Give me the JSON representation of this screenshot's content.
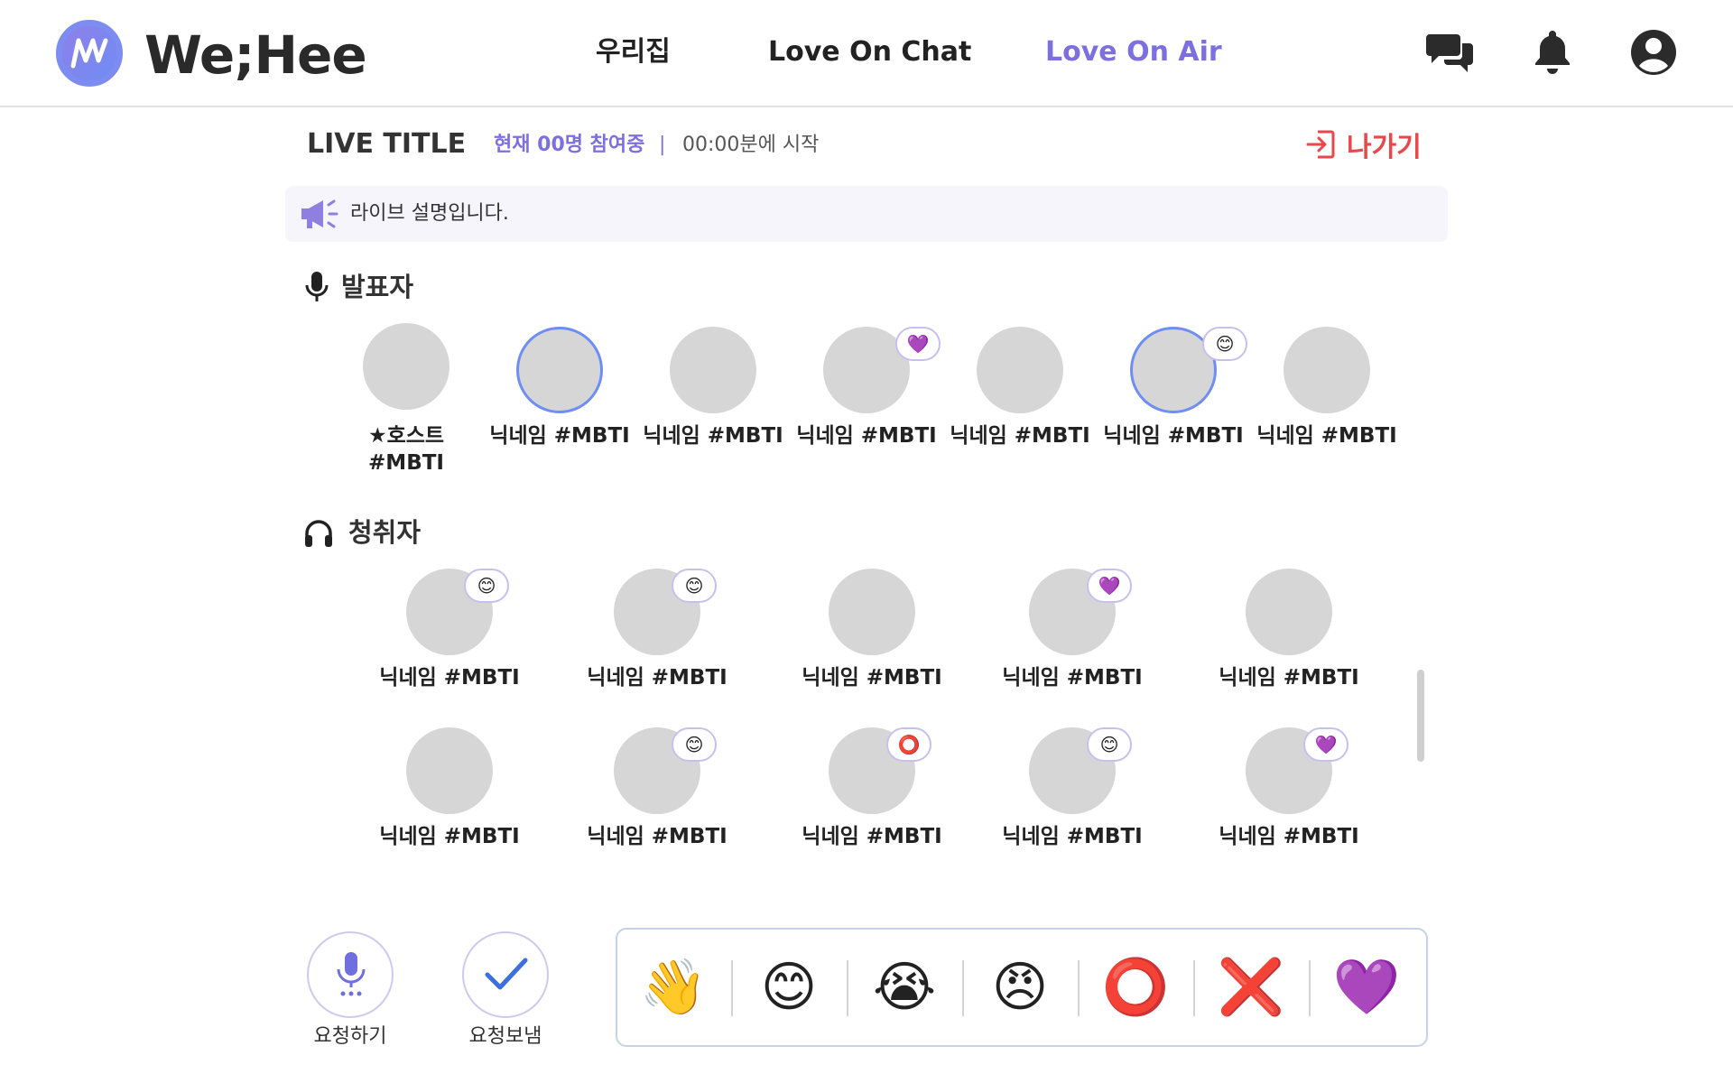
{
  "header": {
    "brand": "We;Hee",
    "nav": [
      "우리집",
      "Love On Chat",
      "Love On Air"
    ],
    "active_nav": "Love On Air",
    "icons": [
      "chat-icon",
      "bell-icon",
      "user-icon"
    ]
  },
  "live": {
    "title": "LIVE TITLE",
    "participants": "현재 00명 참여중",
    "separator": "|",
    "start": "00:00분에 시작",
    "exit_label": "나가기",
    "description": "라이브 설명입니다."
  },
  "speakers": {
    "title": "발표자",
    "items": [
      {
        "name": "호스트 #MBTI",
        "host": true,
        "reaction": ""
      },
      {
        "name": "닉네임 #MBTI",
        "speaking": true,
        "reaction": ""
      },
      {
        "name": "닉네임 #MBTI",
        "reaction": ""
      },
      {
        "name": "닉네임 #MBTI",
        "reaction": "💜"
      },
      {
        "name": "닉네임 #MBTI",
        "reaction": ""
      },
      {
        "name": "닉네임 #MBTI",
        "speaking": true,
        "reaction": "😊"
      },
      {
        "name": "닉네임 #MBTI",
        "reaction": ""
      }
    ]
  },
  "listeners": {
    "title": "청취자",
    "items": [
      {
        "name": "닉네임 #MBTI",
        "reaction": "😊"
      },
      {
        "name": "닉네임 #MBTI",
        "reaction": "😊"
      },
      {
        "name": "닉네임 #MBTI",
        "reaction": ""
      },
      {
        "name": "닉네임 #MBTI",
        "reaction": "💜"
      },
      {
        "name": "닉네임 #MBTI",
        "reaction": ""
      },
      {
        "name": "닉네임 #MBTI",
        "reaction": ""
      },
      {
        "name": "닉네임 #MBTI",
        "reaction": "😊"
      },
      {
        "name": "닉네임 #MBTI",
        "reaction": "⭕"
      },
      {
        "name": "닉네임 #MBTI",
        "reaction": "😊"
      },
      {
        "name": "닉네임 #MBTI",
        "reaction": "💜"
      }
    ]
  },
  "actions": {
    "request_label": "요청하기",
    "sent_label": "요청보냄"
  },
  "reactions": [
    "👋",
    "😊",
    "😭",
    "😠",
    "⭕",
    "❌",
    "💜"
  ],
  "colors": {
    "accent": "#7c6fe0",
    "exit": "#e8484c",
    "avatar": "#d6d6d6",
    "speaking_ring": "#6e8ef5"
  }
}
